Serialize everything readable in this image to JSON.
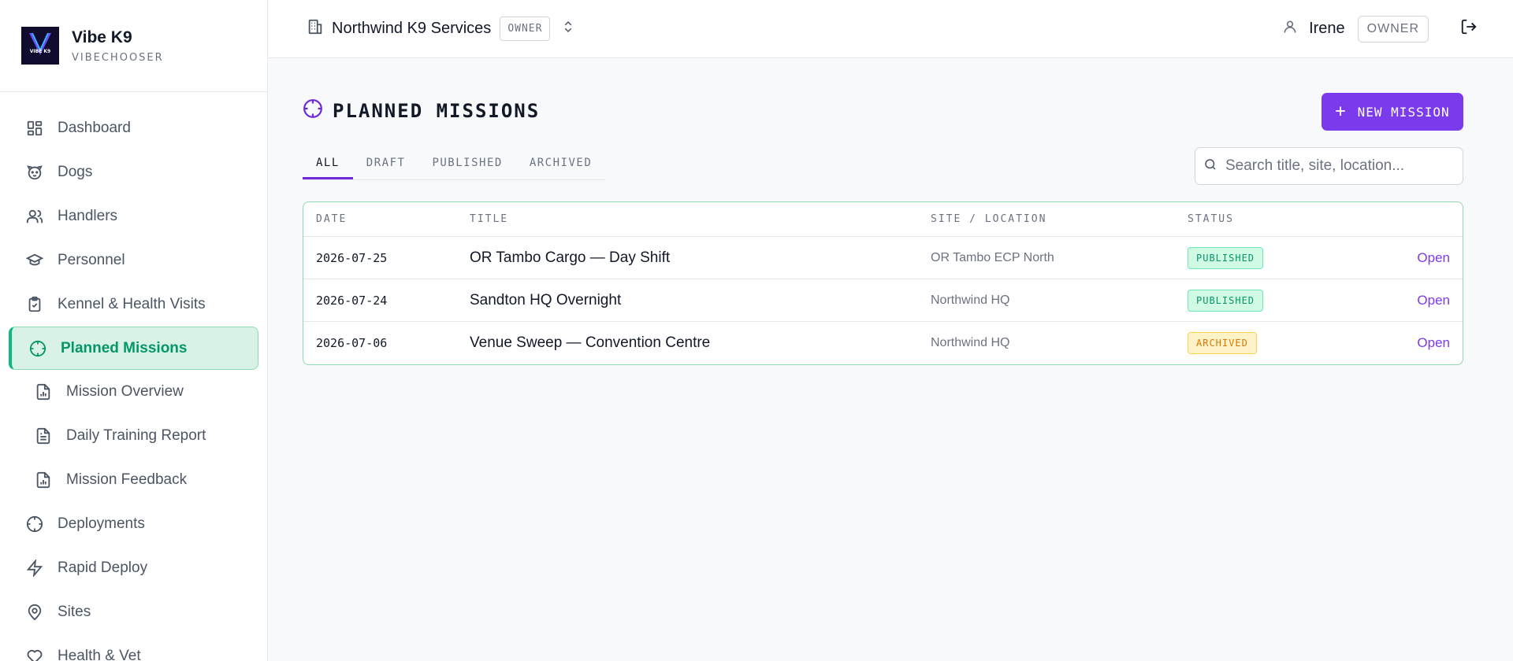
{
  "brand": {
    "name": "Vibe K9",
    "subtitle": "VIBECHOOSER",
    "logo_text": "VIBE K9"
  },
  "sidebar": {
    "items": [
      {
        "label": "Dashboard",
        "icon": "grid-icon"
      },
      {
        "label": "Dogs",
        "icon": "dog-icon"
      },
      {
        "label": "Handlers",
        "icon": "users-icon"
      },
      {
        "label": "Personnel",
        "icon": "graduation-cap-icon"
      },
      {
        "label": "Kennel & Health Visits",
        "icon": "clipboard-check-icon"
      },
      {
        "label": "Planned Missions",
        "icon": "crosshair-icon",
        "active": true
      },
      {
        "label": "Mission Overview",
        "icon": "file-chart-icon",
        "sub": true
      },
      {
        "label": "Daily Training Report",
        "icon": "file-text-icon",
        "sub": true
      },
      {
        "label": "Mission Feedback",
        "icon": "file-chart-icon",
        "sub": true
      },
      {
        "label": "Deployments",
        "icon": "crosshair-icon"
      },
      {
        "label": "Rapid Deploy",
        "icon": "zap-icon"
      },
      {
        "label": "Sites",
        "icon": "map-pin-icon"
      },
      {
        "label": "Health & Vet",
        "icon": "heart-icon"
      }
    ]
  },
  "topbar": {
    "org_name": "Northwind K9 Services",
    "org_role": "OWNER",
    "user_name": "Irene",
    "user_role": "OWNER"
  },
  "page": {
    "title": "PLANNED MISSIONS",
    "new_button": "NEW MISSION",
    "tabs": [
      "ALL",
      "DRAFT",
      "PUBLISHED",
      "ARCHIVED"
    ],
    "active_tab": "ALL",
    "search_placeholder": "Search title, site, location..."
  },
  "table": {
    "columns": [
      "DATE",
      "TITLE",
      "SITE / LOCATION",
      "STATUS"
    ],
    "rows": [
      {
        "date": "2026-07-25",
        "title": "OR Tambo Cargo — Day Shift",
        "site": "OR Tambo ECP North",
        "status": "PUBLISHED",
        "action": "Open"
      },
      {
        "date": "2026-07-24",
        "title": "Sandton HQ Overnight",
        "site": "Northwind HQ",
        "status": "PUBLISHED",
        "action": "Open"
      },
      {
        "date": "2026-07-06",
        "title": "Venue Sweep — Convention Centre",
        "site": "Northwind HQ",
        "status": "ARCHIVED",
        "action": "Open"
      }
    ]
  },
  "colors": {
    "accent": "#7c3aed",
    "active_green": "#10b981",
    "published": "#059669",
    "archived": "#d97706"
  }
}
